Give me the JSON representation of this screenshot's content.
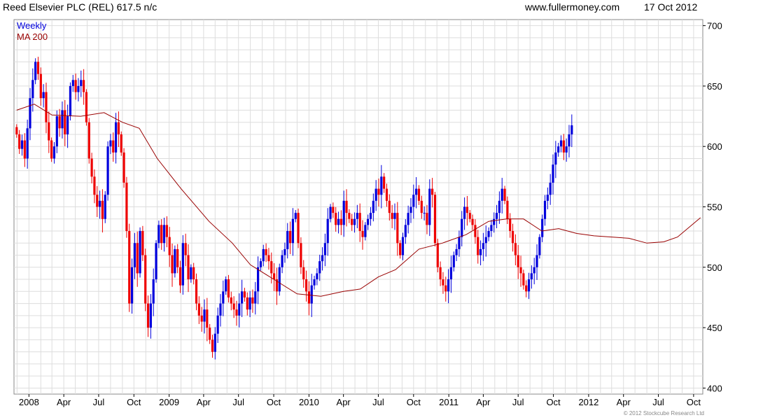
{
  "header": {
    "title": "Reed Elsevier PLC (REL) 617.5 n/c",
    "website": "www.fullermoney.com",
    "date": "17 Oct 2012"
  },
  "footer": {
    "copyright": "© 2012 Stockcube Research Ltd"
  },
  "colors": {
    "up": "#0000dd",
    "down": "#ee0000",
    "ma": "#990000",
    "grid": "#dddddd"
  },
  "chart_data": {
    "type": "line",
    "chart_type_note": "weekly candlestick with moving average",
    "title": "Reed Elsevier PLC (REL) 617.5 n/c",
    "legend": [
      {
        "label": "Weekly",
        "color": "#0000dd"
      },
      {
        "label": "MA 200",
        "color": "#990000"
      }
    ],
    "legend_position": "top-left",
    "y_axis": {
      "side": "right",
      "range": [
        395,
        705
      ],
      "ticks": [
        400,
        450,
        500,
        550,
        600,
        650,
        700
      ]
    },
    "x_axis": {
      "range": [
        "2007-11-23",
        "2012-10-25"
      ],
      "ticks": [
        {
          "label": "2008",
          "date": "2008-01-01"
        },
        {
          "label": "Apr",
          "date": "2008-04-01"
        },
        {
          "label": "Jul",
          "date": "2008-07-01"
        },
        {
          "label": "Oct",
          "date": "2008-10-01"
        },
        {
          "label": "2009",
          "date": "2009-01-01"
        },
        {
          "label": "Apr",
          "date": "2009-04-01"
        },
        {
          "label": "Jul",
          "date": "2009-07-01"
        },
        {
          "label": "Oct",
          "date": "2009-10-01"
        },
        {
          "label": "2010",
          "date": "2010-01-01"
        },
        {
          "label": "Apr",
          "date": "2010-04-01"
        },
        {
          "label": "Jul",
          "date": "2010-07-01"
        },
        {
          "label": "Oct",
          "date": "2010-10-01"
        },
        {
          "label": "2011",
          "date": "2011-01-01"
        },
        {
          "label": "Apr",
          "date": "2011-04-01"
        },
        {
          "label": "Jul",
          "date": "2011-07-01"
        },
        {
          "label": "Oct",
          "date": "2011-10-01"
        },
        {
          "label": "2012",
          "date": "2012-01-01"
        },
        {
          "label": "Apr",
          "date": "2012-04-01"
        },
        {
          "label": "Jul",
          "date": "2012-07-01"
        },
        {
          "label": "Oct",
          "date": "2012-10-01"
        }
      ]
    },
    "grid": true,
    "series": [
      {
        "name": "Weekly",
        "type": "candlestick",
        "start_date": "2007-11-30",
        "interval_days": 7,
        "close": [
          610,
          598,
          605,
          590,
          615,
          640,
          655,
          670,
          660,
          640,
          645,
          620,
          605,
          590,
          600,
          625,
          615,
          630,
          610,
          625,
          650,
          655,
          645,
          650,
          655,
          645,
          620,
          590,
          575,
          560,
          550,
          555,
          540,
          560,
          600,
          605,
          595,
          620,
          610,
          595,
          570,
          530,
          470,
          500,
          520,
          495,
          530,
          510,
          470,
          450,
          470,
          490,
          520,
          535,
          520,
          535,
          525,
          510,
          495,
          515,
          500,
          485,
          520,
          510,
          490,
          500,
          490,
          470,
          460,
          455,
          465,
          450,
          440,
          430,
          445,
          460,
          470,
          480,
          490,
          475,
          470,
          465,
          460,
          470,
          480,
          475,
          465,
          475,
          470,
          480,
          500,
          505,
          515,
          510,
          505,
          495,
          490,
          480,
          500,
          510,
          515,
          530,
          520,
          540,
          545,
          520,
          500,
          490,
          480,
          470,
          485,
          490,
          495,
          505,
          510,
          520,
          540,
          550,
          545,
          535,
          540,
          535,
          555,
          545,
          540,
          535,
          540,
          545,
          530,
          525,
          535,
          540,
          545,
          555,
          565,
          560,
          575,
          565,
          555,
          545,
          540,
          545,
          520,
          510,
          525,
          535,
          545,
          550,
          560,
          565,
          555,
          545,
          545,
          535,
          565,
          560,
          520,
          500,
          490,
          485,
          480,
          490,
          500,
          510,
          515,
          525,
          540,
          550,
          545,
          540,
          535,
          525,
          510,
          515,
          520,
          525,
          530,
          535,
          540,
          545,
          555,
          565,
          555,
          540,
          530,
          520,
          510,
          500,
          495,
          485,
          480,
          490,
          495,
          500,
          510,
          525,
          540,
          555,
          560,
          570,
          585,
          595,
          600,
          605,
          595,
          600,
          610,
          617.5
        ]
      },
      {
        "name": "MA 200",
        "type": "line",
        "points": [
          [
            "2007-11-30",
            630
          ],
          [
            "2008-01-15",
            635
          ],
          [
            "2008-03-01",
            626
          ],
          [
            "2008-05-15",
            625
          ],
          [
            "2008-07-15",
            628
          ],
          [
            "2008-09-01",
            620
          ],
          [
            "2008-10-15",
            615
          ],
          [
            "2008-12-01",
            590
          ],
          [
            "2009-02-01",
            565
          ],
          [
            "2009-04-15",
            538
          ],
          [
            "2009-06-15",
            520
          ],
          [
            "2009-08-01",
            502
          ],
          [
            "2009-10-01",
            490
          ],
          [
            "2009-12-01",
            478
          ],
          [
            "2010-02-01",
            476
          ],
          [
            "2010-04-01",
            480
          ],
          [
            "2010-05-15",
            482
          ],
          [
            "2010-07-01",
            492
          ],
          [
            "2010-08-15",
            498
          ],
          [
            "2010-10-15",
            515
          ],
          [
            "2010-12-15",
            520
          ],
          [
            "2011-02-15",
            527
          ],
          [
            "2011-04-15",
            538
          ],
          [
            "2011-06-01",
            540
          ],
          [
            "2011-07-15",
            540
          ],
          [
            "2011-09-01",
            530
          ],
          [
            "2011-10-15",
            532
          ],
          [
            "2011-12-01",
            528
          ],
          [
            "2012-01-15",
            526
          ],
          [
            "2012-03-01",
            525
          ],
          [
            "2012-04-15",
            524
          ],
          [
            "2012-06-01",
            520
          ],
          [
            "2012-07-15",
            521
          ],
          [
            "2012-08-20",
            525
          ],
          [
            "2012-10-19",
            541
          ]
        ]
      }
    ]
  }
}
